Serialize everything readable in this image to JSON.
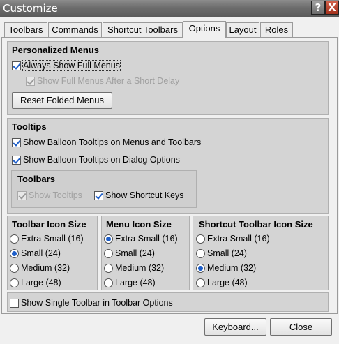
{
  "window": {
    "title": "Customize",
    "help_glyph": "?",
    "close_glyph": "X"
  },
  "tabs": [
    {
      "label": "Toolbars",
      "active": false
    },
    {
      "label": "Commands",
      "active": false
    },
    {
      "label": "Shortcut Toolbars",
      "active": false
    },
    {
      "label": "Options",
      "active": true
    },
    {
      "label": "Layout",
      "active": false
    },
    {
      "label": "Roles",
      "active": false
    }
  ],
  "personalized_menus": {
    "title": "Personalized Menus",
    "always_show_full": {
      "label": "Always Show Full Menus",
      "checked": true
    },
    "show_after_delay": {
      "label": "Show Full Menus After a Short Delay",
      "checked": true,
      "enabled": false
    },
    "reset_button": "Reset Folded Menus"
  },
  "tooltips": {
    "title": "Tooltips",
    "balloon_menus": {
      "label": "Show Balloon Tooltips on Menus and Toolbars",
      "checked": true
    },
    "balloon_dialog": {
      "label": "Show Balloon Tooltips on Dialog Options",
      "checked": true
    },
    "toolbars": {
      "title": "Toolbars",
      "show_tooltips": {
        "label": "Show Tooltips",
        "checked": true,
        "enabled": false
      },
      "show_shortcut_keys": {
        "label": "Show Shortcut Keys",
        "checked": true
      }
    }
  },
  "toolbar_icon_size": {
    "title": "Toolbar Icon Size",
    "options": [
      "Extra Small (16)",
      "Small (24)",
      "Medium (32)",
      "Large (48)"
    ],
    "selected": "Small (24)"
  },
  "menu_icon_size": {
    "title": "Menu Icon Size",
    "options": [
      "Extra Small (16)",
      "Small (24)",
      "Medium (32)",
      "Large (48)"
    ],
    "selected": "Extra Small (16)"
  },
  "shortcut_toolbar_icon_size": {
    "title": "Shortcut Toolbar Icon Size",
    "options": [
      "Extra Small (16)",
      "Small (24)",
      "Medium (32)",
      "Large (48)"
    ],
    "selected": "Medium (32)"
  },
  "single_toolbar": {
    "label": "Show Single Toolbar in Toolbar Options",
    "checked": false
  },
  "buttons": {
    "keyboard": "Keyboard...",
    "close": "Close"
  }
}
